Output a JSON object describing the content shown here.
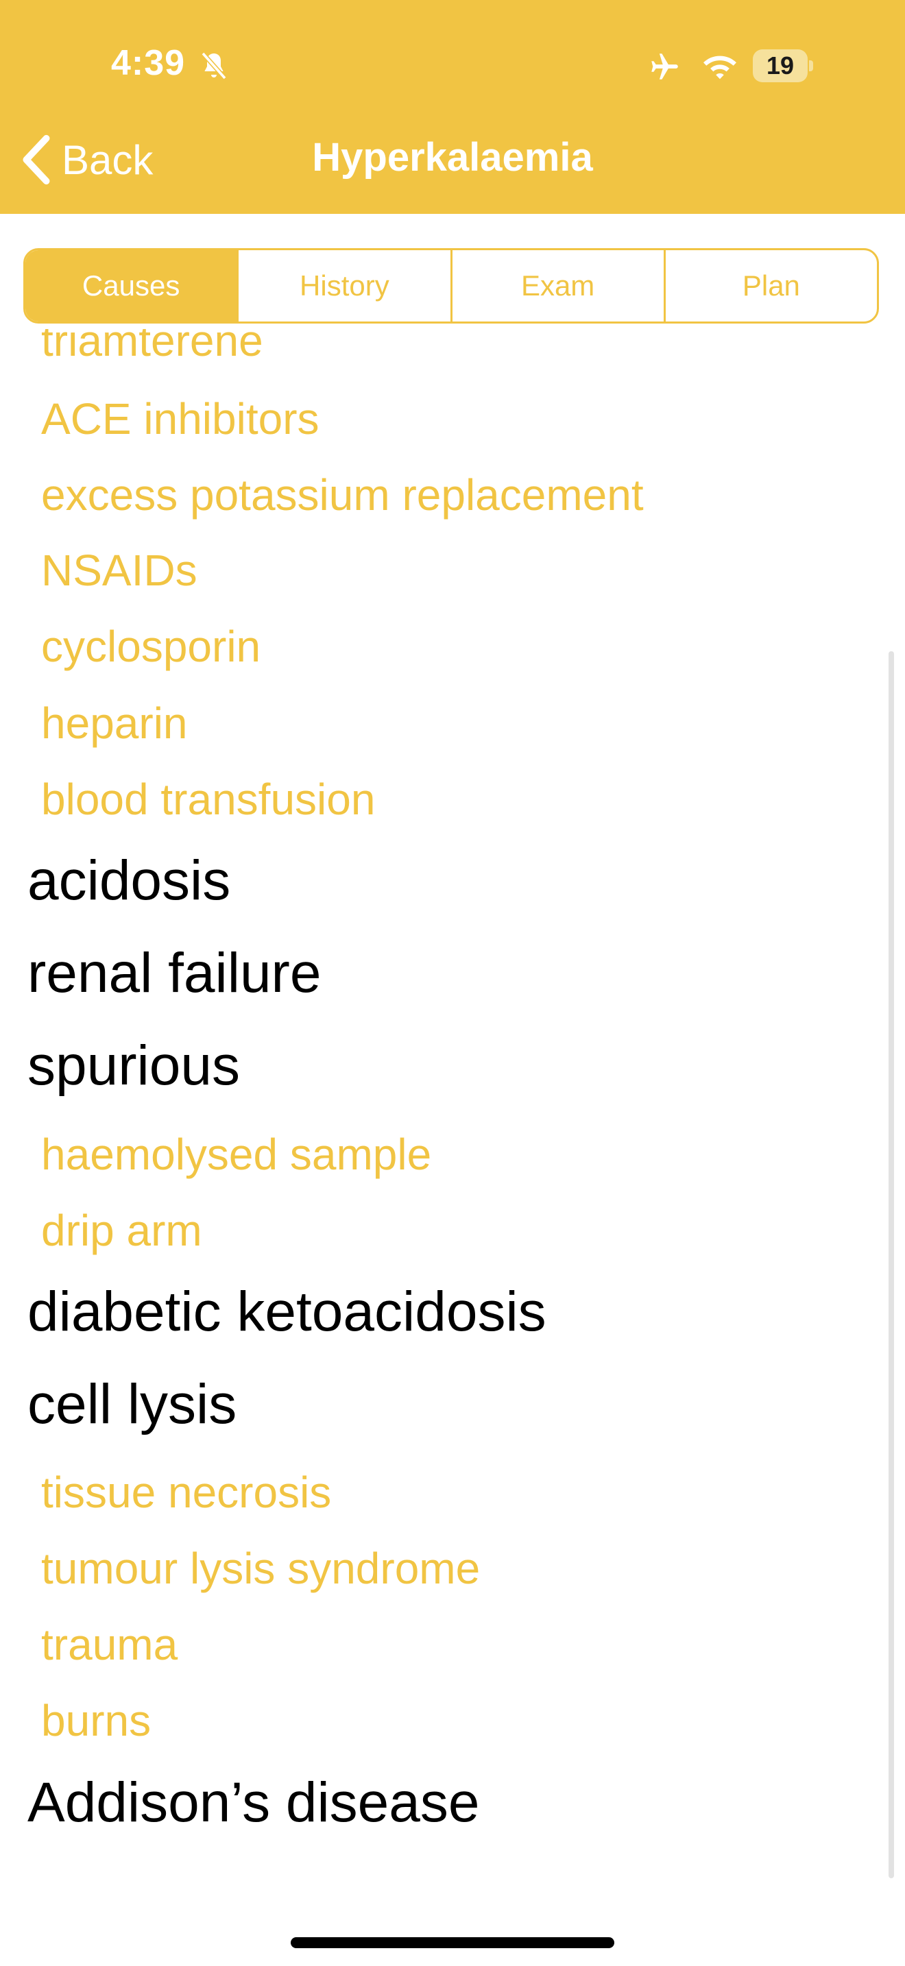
{
  "status_bar": {
    "time": "4:39",
    "battery": "19",
    "icons": [
      "bell-slash-icon",
      "airplane-icon",
      "wifi-icon",
      "battery-icon"
    ]
  },
  "nav": {
    "back_label": "Back",
    "title": "Hyperkalaemia"
  },
  "tabs": [
    {
      "label": "Causes",
      "active": true
    },
    {
      "label": "History",
      "active": false
    },
    {
      "label": "Exam",
      "active": false
    },
    {
      "label": "Plan",
      "active": false
    }
  ],
  "content": {
    "items": [
      {
        "text": "triamterene",
        "kind": "sub"
      },
      {
        "text": "ACE inhibitors",
        "kind": "sub"
      },
      {
        "text": "excess potassium replacement",
        "kind": "sub"
      },
      {
        "text": "NSAIDs",
        "kind": "sub"
      },
      {
        "text": "cyclosporin",
        "kind": "sub"
      },
      {
        "text": "heparin",
        "kind": "sub"
      },
      {
        "text": "blood transfusion",
        "kind": "sub"
      },
      {
        "text": "acidosis",
        "kind": "main"
      },
      {
        "text": "renal failure",
        "kind": "main"
      },
      {
        "text": "spurious",
        "kind": "main"
      },
      {
        "text": "haemolysed sample",
        "kind": "sub"
      },
      {
        "text": "drip arm",
        "kind": "sub"
      },
      {
        "text": "diabetic ketoacidosis",
        "kind": "main"
      },
      {
        "text": "cell lysis",
        "kind": "main"
      },
      {
        "text": "tissue necrosis",
        "kind": "sub"
      },
      {
        "text": "tumour lysis syndrome",
        "kind": "sub"
      },
      {
        "text": "trauma",
        "kind": "sub"
      },
      {
        "text": "burns",
        "kind": "sub"
      },
      {
        "text": "Addison’s disease",
        "kind": "main"
      }
    ]
  },
  "colors": {
    "accent": "#f1c443",
    "text_main": "#000000",
    "background": "#ffffff"
  }
}
